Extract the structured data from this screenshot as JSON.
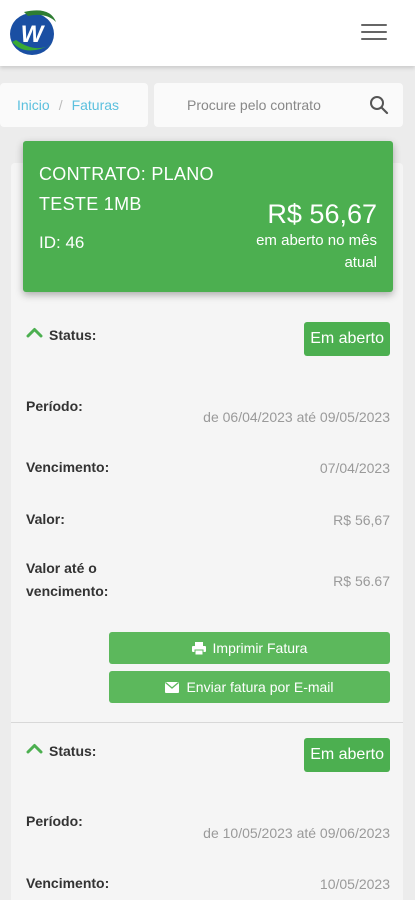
{
  "header": {
    "logo_letter": "W",
    "menu_icon": "hamburger-menu-icon"
  },
  "breadcrumb": {
    "home": "Inicio",
    "separator": "/",
    "current": "Faturas"
  },
  "search": {
    "placeholder": "Procure pelo contrato",
    "icon": "search-icon"
  },
  "contract": {
    "title": "CONTRATO: PLANO TESTE 1MB",
    "id": "ID: 46",
    "amount": "R$ 56,67",
    "amount_note": "em aberto no mês atual"
  },
  "invoices": [
    {
      "status_label": "Status:",
      "status_badge": "Em aberto",
      "period_label": "Período:",
      "period_value": "de 06/04/2023 até 09/05/2023",
      "due_label": "Vencimento:",
      "due_value": "07/04/2023",
      "value_label": "Valor:",
      "value_value": "R$ 56,67",
      "value_due_label": "Valor até o vencimento:",
      "value_due_value": "R$ 56.67",
      "print_label": "Imprimir Fatura",
      "email_label": "Enviar fatura por E-mail"
    },
    {
      "status_label": "Status:",
      "status_badge": "Em aberto",
      "period_label": "Período:",
      "period_value": "de 10/05/2023 até 09/06/2023",
      "due_label": "Vencimento:",
      "due_value": "10/05/2023"
    }
  ],
  "colors": {
    "accent_green": "#4caf50",
    "button_green": "#5cb85c",
    "link_blue": "#5bc0de"
  }
}
